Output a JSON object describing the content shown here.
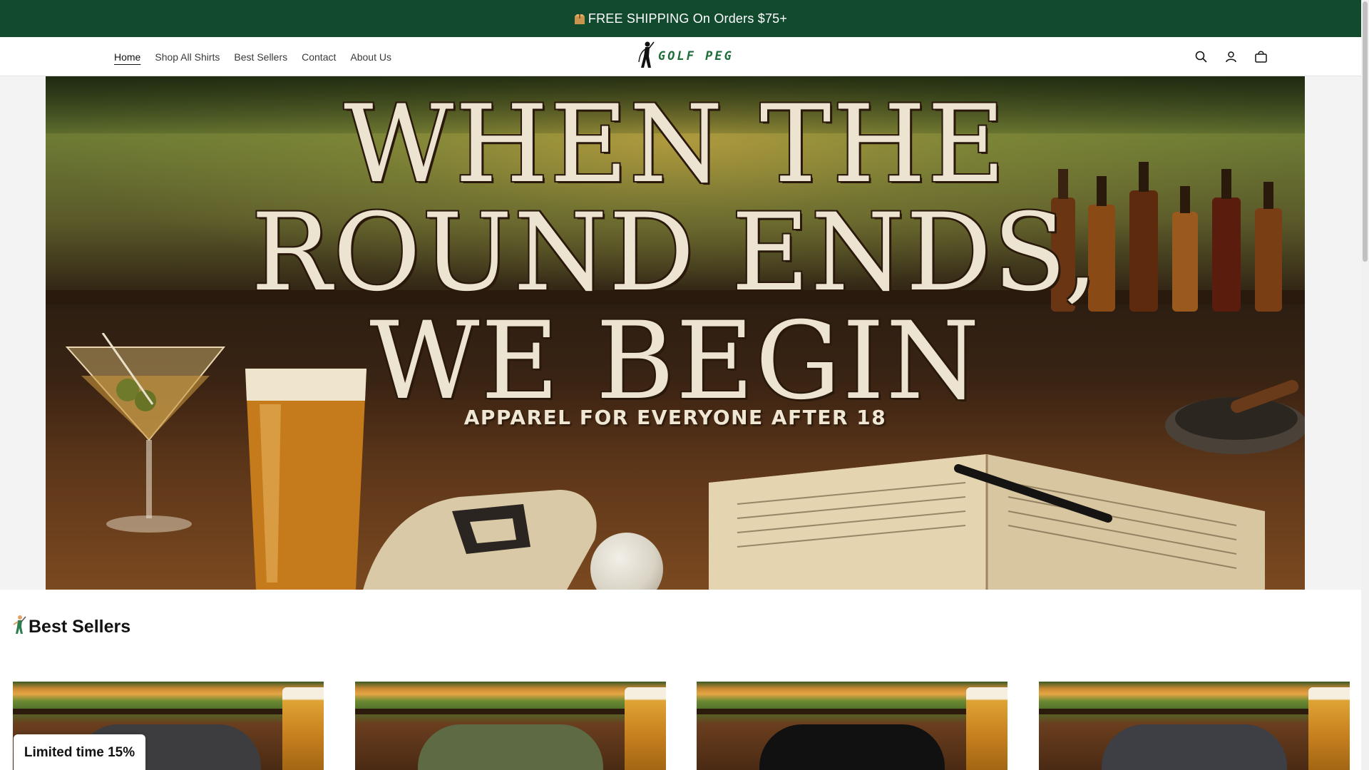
{
  "announcement": {
    "icon": "package-icon",
    "text": "FREE SHIPPING On Orders $75+"
  },
  "nav": {
    "items": [
      {
        "label": "Home",
        "active": true
      },
      {
        "label": "Shop All Shirts"
      },
      {
        "label": "Best Sellers"
      },
      {
        "label": "Contact"
      },
      {
        "label": "About Us"
      }
    ]
  },
  "logo": {
    "text": "GOLF PEG",
    "icon": "golfer-silhouette-icon"
  },
  "header_icons": [
    "search-icon",
    "account-icon",
    "cart-icon"
  ],
  "hero": {
    "title_lines": [
      "WHEN THE",
      "ROUND ENDS,",
      "WE BEGIN"
    ],
    "subtitle": "APPAREL FOR EVERYONE AFTER 18"
  },
  "best_sellers": {
    "icon": "golfer-icon",
    "title": "Best Sellers"
  },
  "products": [
    {
      "shirt_color": "#3d3d3f"
    },
    {
      "shirt_color": "#5d6a43"
    },
    {
      "shirt_color": "#111111"
    },
    {
      "shirt_color": "#3e3f44"
    }
  ],
  "promo": {
    "label": "Limited time 15%"
  },
  "colors": {
    "announcement_bg": "#124a2e",
    "logo_green": "#1e6e3a"
  }
}
